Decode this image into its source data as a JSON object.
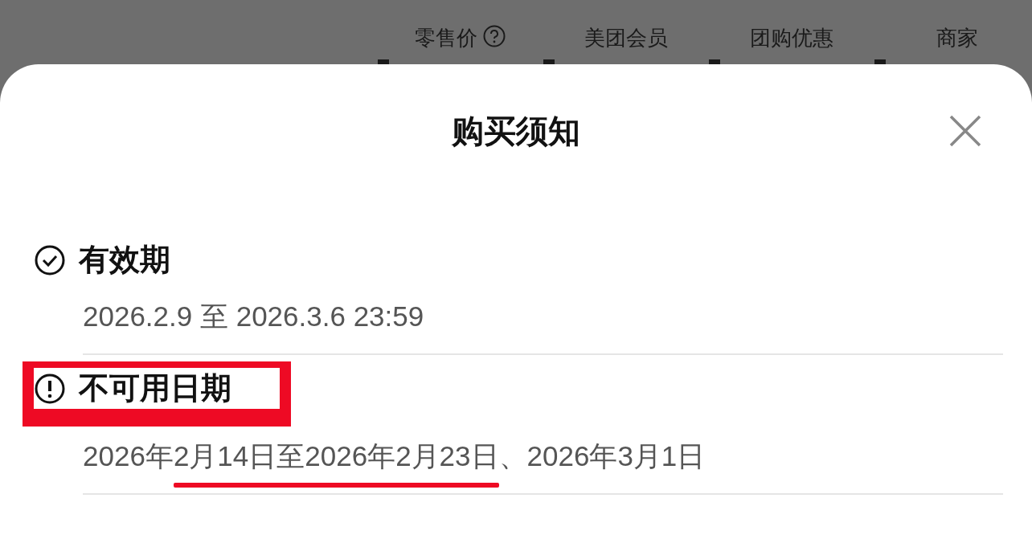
{
  "background": {
    "tabs": [
      {
        "label": "零售价",
        "help": true
      },
      {
        "label": "美团会员",
        "help": false
      },
      {
        "label": "团购优惠",
        "help": false
      },
      {
        "label": "商家",
        "help": false
      }
    ]
  },
  "sheet": {
    "title": "购买须知",
    "sections": [
      {
        "kind": "valid",
        "title": "有效期",
        "boxed": false,
        "segments": [
          {
            "text": "2026.2.9 至 2026.3.6 23:59"
          }
        ]
      },
      {
        "kind": "unavailable",
        "title": "不可用日期",
        "boxed": true,
        "segments": [
          {
            "text": "2026年"
          },
          {
            "text": "2月14日至2026年2月23日",
            "underlined": true
          },
          {
            "text": "、2026年3月1日"
          }
        ]
      }
    ]
  }
}
